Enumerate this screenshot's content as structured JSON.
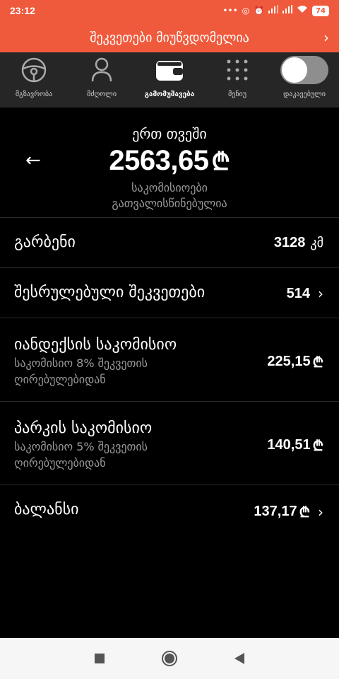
{
  "status": {
    "time": "23:12",
    "icons": [
      "more-dots-icon",
      "ring-icon",
      "alarm-icon",
      "signal-icon",
      "signal-icon",
      "wifi-icon"
    ],
    "battery": "74"
  },
  "banner": {
    "text": "შეკვეთები მიუწვდომელია"
  },
  "nav": {
    "items": [
      {
        "label": "მგზავრობა",
        "icon": "steering-wheel-icon"
      },
      {
        "label": "მძღოლი",
        "icon": "person-icon"
      },
      {
        "label": "გამომუშავება",
        "icon": "wallet-icon"
      },
      {
        "label": "მენიუ",
        "icon": "grid-dots-icon"
      },
      {
        "label": "დაკავებული",
        "icon": "toggle-icon"
      }
    ]
  },
  "header": {
    "period": "ერთ თვეში",
    "amount": "2563,65",
    "currency": "₾",
    "sub1": "საკომისიოები",
    "sub2": "გათვალისწინებულია"
  },
  "rows": [
    {
      "title": "გარბენი",
      "value": "3128",
      "unit": "კმ"
    },
    {
      "title": "შესრულებული შეკვეთები",
      "value": "514"
    },
    {
      "title": "იანდექსის საკომისიო",
      "subtitle_line1": "საკომისიო 8% შეკვეთის",
      "subtitle_line2": "ღირებულებიდან",
      "value": "225,15",
      "currency": "₾"
    },
    {
      "title": "პარკის საკომისიო",
      "subtitle_line1": "საკომისიო 5% შეკვეთის",
      "subtitle_line2": "ღირებულებიდან",
      "value": "140,51",
      "currency": "₾"
    },
    {
      "title": "ბალანსი",
      "value": "137,17",
      "currency": "₾"
    }
  ],
  "colors": {
    "accent": "#f05a3c",
    "nav_bg": "#262626",
    "background": "#000000",
    "muted_text": "#9a9a9a"
  }
}
